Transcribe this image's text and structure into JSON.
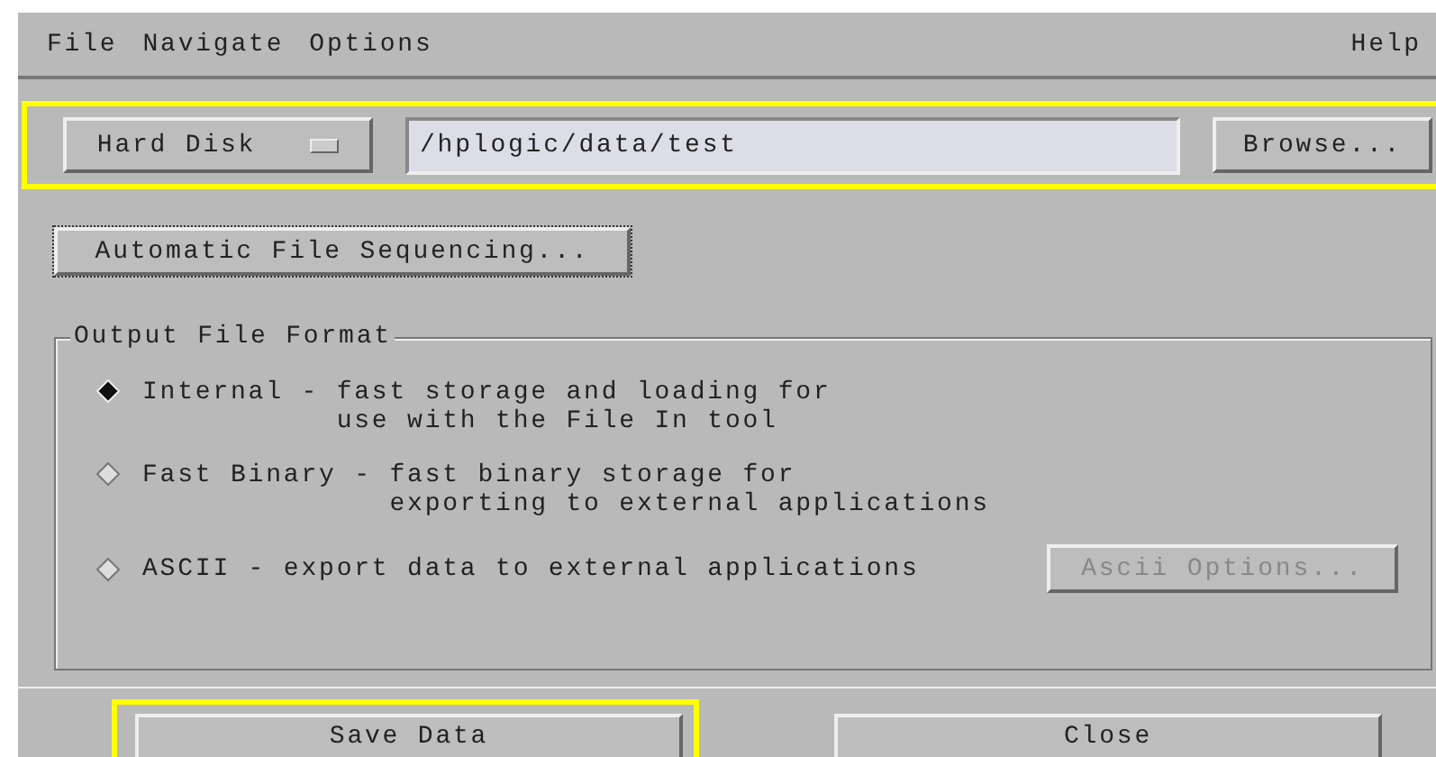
{
  "menu_bar": {
    "items": [
      "File",
      "Navigate",
      "Options"
    ],
    "help": "Help"
  },
  "location": {
    "highlighted": true,
    "device": "Hard Disk",
    "path": "/hplogic/data/test",
    "browse": "Browse..."
  },
  "sequencing_button": {
    "label": "Automatic File Sequencing...",
    "focused": true
  },
  "output_format": {
    "title": "Output File Format",
    "options": [
      {
        "label": "Internal - fast storage and loading for\n           use with the File In tool",
        "selected": true
      },
      {
        "label": "Fast Binary - fast binary storage for\n              exporting to external applications",
        "selected": false
      },
      {
        "label": "ASCII - export data to external applications",
        "selected": false,
        "button": {
          "label": "Ascii Options...",
          "disabled": true
        }
      }
    ]
  },
  "buttons": [
    {
      "label": "Save Data",
      "highlighted": true
    },
    {
      "label": "Close",
      "highlighted": false
    }
  ]
}
